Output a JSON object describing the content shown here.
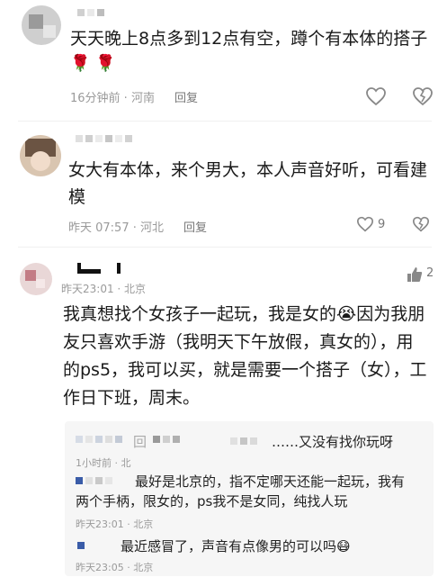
{
  "comments": [
    {
      "text": "天天晚上8点多到12点有空，蹲个有本体的搭子",
      "emoji": "🌹🌹",
      "time_location": "16分钟前 · 河南",
      "reply_label": "回复",
      "like_count": ""
    },
    {
      "text": "女大有本体，来个男大，本人声音好听，可看建模",
      "time_location": "昨天 07:57 · 河北",
      "reply_label": "回复",
      "like_count": "9"
    },
    {
      "time_location": "昨天23:01 · 北京",
      "text": "我真想找个女孩子一起玩，我是女的😭因为我朋友只喜欢手游（我明天下午放假，真女的），用的ps5，我可以买，就是需要一个搭子（女），工作日下班，周末。",
      "like_count": "2",
      "replies": [
        {
          "prefix": "回",
          "text": "……又没有找你玩呀",
          "time": "1小时前 · 北"
        },
        {
          "text": "最好是北京的，指不定哪天还能一起玩，我有两个手柄，限女的，ps我不是女同，纯找人玩",
          "time": "昨天23:01 · 北京"
        },
        {
          "text": "最近感冒了，声音有点像男的可以吗😷",
          "time": "昨天23:05 · 北京"
        }
      ]
    }
  ],
  "colors": {
    "meta": "#9a9a9a",
    "reply_bg": "#f6f6f6"
  }
}
